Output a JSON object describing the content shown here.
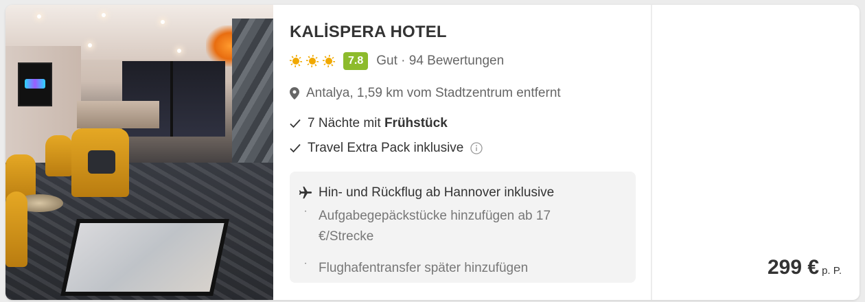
{
  "hotel": {
    "name": "KALİSPERA HOTEL",
    "stars": 3,
    "score": "7.8",
    "rating_text": "Gut · 94 Bewertungen",
    "location": "Antalya, 1,59 km vom Stadtzentrum entfernt"
  },
  "features": {
    "nights_prefix": "7 Nächte mit ",
    "nights_board": "Frühstück",
    "extra_pack": "Travel Extra Pack inklusive"
  },
  "flight": {
    "title": "Hin- und Rückflug ab Hannover inklusive",
    "bullet_symbol": "•",
    "baggage": "Aufgabegepäckstücke hinzufügen ab 17 €/Strecke",
    "transfer": "Flughafentransfer später hinzufügen"
  },
  "price": {
    "amount": "299 €",
    "unit": "p. P."
  },
  "colors": {
    "score_badge": "#8dbb2c",
    "sun": "#f0a800",
    "flight_box": "#f3f3f3"
  },
  "icons": [
    "sun-icon",
    "location-pin-icon",
    "check-icon",
    "info-icon",
    "plane-icon"
  ]
}
